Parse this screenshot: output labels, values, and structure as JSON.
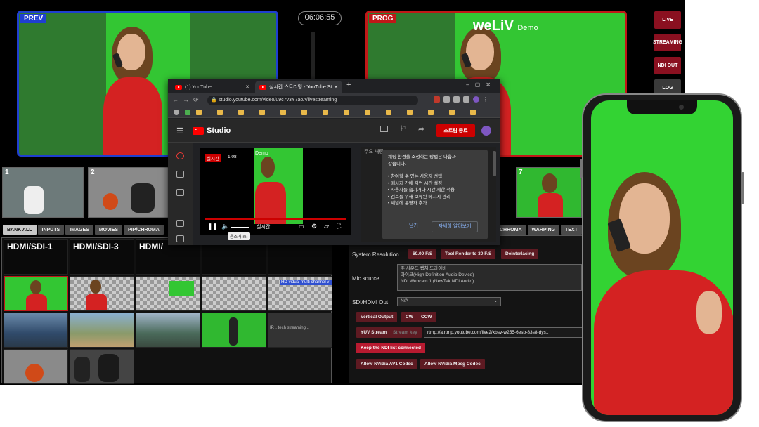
{
  "monitors": {
    "preview_label": "PREV",
    "program_label": "PROG",
    "watermark_brand": "weLiV",
    "watermark_suffix": "Demo",
    "clock": "06:06:55"
  },
  "side_buttons": [
    {
      "label": "LIVE",
      "style": "red"
    },
    {
      "label": "STREAMING",
      "style": "red"
    },
    {
      "label": "NDI OUT",
      "style": "red"
    },
    {
      "label": "LOG",
      "style": "gray"
    }
  ],
  "input_bank": [
    {
      "num": "1"
    },
    {
      "num": "2"
    },
    {
      "num": "7"
    }
  ],
  "category_tabs": {
    "left": [
      "BANK ALL",
      "INPUTS",
      "IMAGES",
      "MOVIES",
      "PIP/CHROMA"
    ],
    "right": [
      "CHROMA",
      "WARPING",
      "TEXT"
    ]
  },
  "grid_headers": [
    "HDMI/SDI-1",
    "HDMI/SDI-3",
    "HDMI/"
  ],
  "grid_cells": {
    "ticker_text": "HD-vidual multi-channel v",
    "tooltip_text": "IP... tech streaming..."
  },
  "settings": {
    "system_resolution_label": "System Resolution",
    "fps_button": "60.00 F/S",
    "tool_render_button": "Tool Render to 30 F/S",
    "deinterlacing_button": "Deinterlacing",
    "mic_source_label": "Mic source",
    "mic_options": [
      "주 사운드 캡처 드라이버",
      "마이크(High Definition Audio Device)",
      "NDI Webcam 1 (NewTek NDI Audio)"
    ],
    "sdi_out_label": "SDI/HDMI Out",
    "sdi_out_value": "N/A",
    "vertical_output_button": "Vertical Output",
    "cw_button": "CW",
    "ccw_button": "CCW",
    "yuv_stream_button": "YUV Stream",
    "stream_key_button": "Stream key",
    "rtmp_url": "rtmp://a.rtmp.youtube.com/live2/xbsv-w255-6esb-83s8-dys1",
    "ndi_list_button": "Keep the NDI list connected",
    "av1_button": "Allow NVidia AV1 Codec",
    "mpeg_button": "Allow NVidia Mpeg Codec"
  },
  "browser": {
    "tab1_title": "(1) YouTube",
    "tab2_title": "실시간 스트리밍 - YouTube Studio",
    "url": "studio.youtube.com/video/u9c7v3Y7aoA/livestreaming",
    "studio_label": "Studio",
    "end_stream_button": "스트림 종료",
    "live_badge": "실시간",
    "live_time": "1:08",
    "player_live_label": "실시간",
    "player_tooltip": "음소거(m)",
    "player_watermark": "Demo",
    "chat_header": "주요 채팅",
    "tip_text": [
      "채팅 환경을 조성하는 방법은 다음과",
      "같습니다.",
      "",
      "• 참여할 수 있는 사용자 선택",
      "• 메시지 간에 지연 시간 설정",
      "• 사용자를 숨기거나 시간 제한 적용",
      "• 검토를 위해 보류된 메시지 관리",
      "• 채널에 운영자 추가"
    ],
    "tip_close": "닫기",
    "tip_learn_more": "자세히 알아보기"
  },
  "colors": {
    "accent_red": "#b81a30",
    "preview_blue": "#1f3fd0",
    "program_red": "#c01818",
    "chroma_green": "#33c633"
  }
}
